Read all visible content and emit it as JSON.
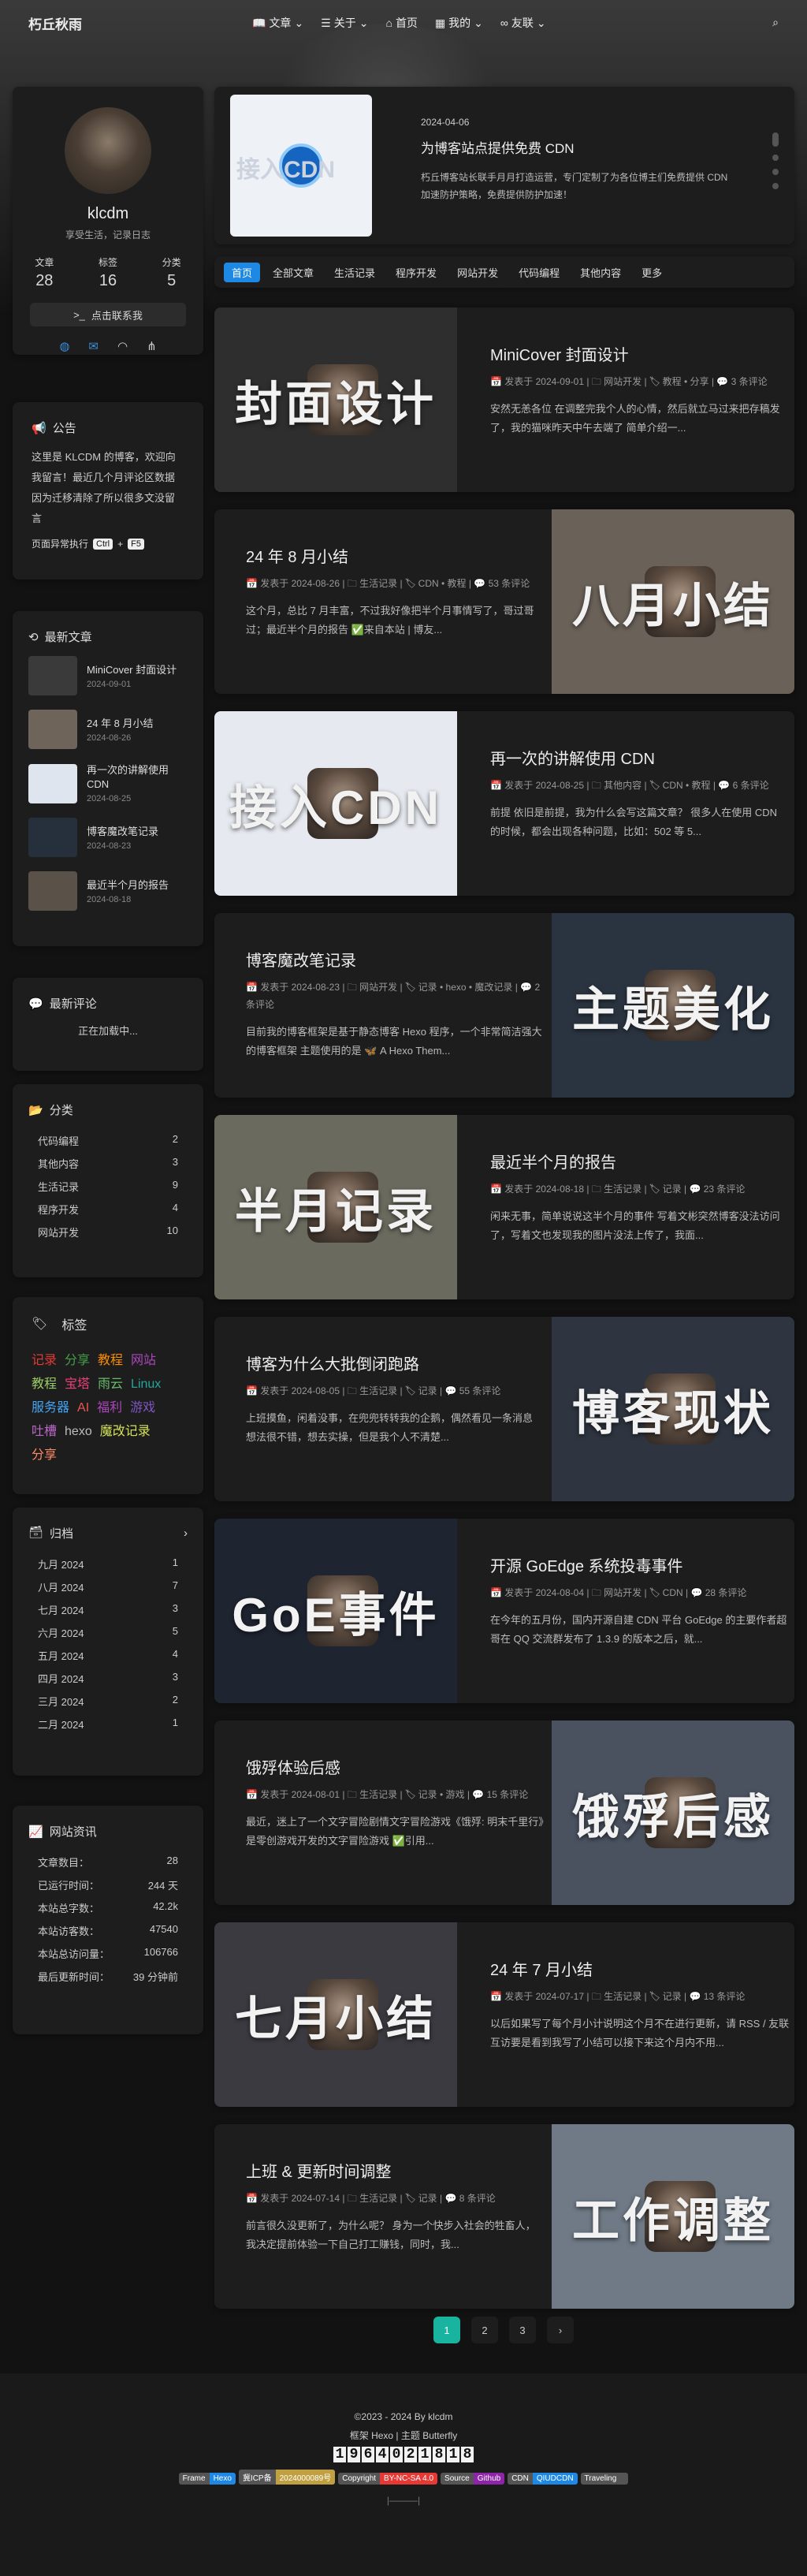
{
  "nav": {
    "brand": "朽丘秋雨",
    "items": [
      "文章",
      "关于",
      "首页",
      "我的",
      "友联"
    ]
  },
  "profile": {
    "name": "klcdm",
    "motto": "享受生活，记录日志",
    "stats": [
      {
        "label": "文章",
        "value": "28"
      },
      {
        "label": "标签",
        "value": "16"
      },
      {
        "label": "分类",
        "value": "5"
      }
    ],
    "contact": "点击联系我"
  },
  "notice": {
    "title": "公告",
    "text": "这里是 KLCDM 的博客，欢迎向我留言！最近几个月评论区数据因为迁移清除了所以很多文没留言",
    "exec_label": "页面异常执行",
    "keys": [
      "Ctrl",
      "+",
      "F5"
    ]
  },
  "recent": {
    "title": "最新文章",
    "items": [
      {
        "title": "MiniCover 封面设计",
        "date": "2024-09-01"
      },
      {
        "title": "24 年 8 月小结",
        "date": "2024-08-26"
      },
      {
        "title": "再一次的讲解使用 CDN",
        "date": "2024-08-25"
      },
      {
        "title": "博客魔改笔记录",
        "date": "2024-08-23"
      },
      {
        "title": "最近半个月的报告",
        "date": "2024-08-18"
      }
    ]
  },
  "comments": {
    "title": "最新评论",
    "loading": "正在加载中..."
  },
  "categories": {
    "title": "分类",
    "items": [
      {
        "name": "代码编程",
        "count": "2"
      },
      {
        "name": "其他内容",
        "count": "3"
      },
      {
        "name": "生活记录",
        "count": "9"
      },
      {
        "name": "程序开发",
        "count": "4"
      },
      {
        "name": "网站开发",
        "count": "10"
      }
    ]
  },
  "tags": {
    "title": "标签",
    "items": [
      {
        "name": "记录",
        "color": "#e53935"
      },
      {
        "name": "分享",
        "color": "#43a047"
      },
      {
        "name": "教程",
        "color": "#fb8c00"
      },
      {
        "name": "网站",
        "color": "#ab47bc"
      },
      {
        "name": "教程",
        "color": "#9ccc65"
      },
      {
        "name": "宝塔",
        "color": "#ec407a"
      },
      {
        "name": "雨云",
        "color": "#66bb6a"
      },
      {
        "name": "Linux",
        "color": "#26a69a"
      },
      {
        "name": "服务器",
        "color": "#42a5f5"
      },
      {
        "name": "AI",
        "color": "#ef5350"
      },
      {
        "name": "福利",
        "color": "#ab47bc"
      },
      {
        "name": "游戏",
        "color": "#7e57c2"
      },
      {
        "name": "吐槽",
        "color": "#ba68c8"
      },
      {
        "name": "hexo",
        "color": "#bdbdbd"
      },
      {
        "name": "魔改记录",
        "color": "#d4e157"
      },
      {
        "name": "分享",
        "color": "#ff8a65"
      }
    ]
  },
  "archive": {
    "title": "归档",
    "items": [
      {
        "m": "九月 2024",
        "c": "1"
      },
      {
        "m": "八月 2024",
        "c": "7"
      },
      {
        "m": "七月 2024",
        "c": "3"
      },
      {
        "m": "六月 2024",
        "c": "5"
      },
      {
        "m": "五月 2024",
        "c": "4"
      },
      {
        "m": "四月 2024",
        "c": "3"
      },
      {
        "m": "三月 2024",
        "c": "2"
      },
      {
        "m": "二月 2024",
        "c": "1"
      }
    ]
  },
  "siteinfo": {
    "title": "网站资讯",
    "items": [
      {
        "k": "文章数目：",
        "v": "28"
      },
      {
        "k": "已运行时间：",
        "v": "244 天"
      },
      {
        "k": "本站总字数：",
        "v": "42.2k"
      },
      {
        "k": "本站访客数：",
        "v": "47540"
      },
      {
        "k": "本站总访问量：",
        "v": "106766"
      },
      {
        "k": "最后更新时间：",
        "v": "39 分钟前"
      }
    ]
  },
  "featured": {
    "date": "2024-04-06",
    "title": "为博客站点提供免费 CDN",
    "desc": "朽丘博客站长联手月月打造运营，专门定制了为各位博主们免费提供 CDN 加速防护策略，免费提供防护加速！",
    "img_text": "接入CDN"
  },
  "cats_bar": [
    "首页",
    "全部文章",
    "生活记录",
    "程序开发",
    "网站开发",
    "代码编程",
    "其他内容",
    "更多"
  ],
  "posts": [
    {
      "title": "MiniCover 封面设计",
      "date": "发表于 2024-09-01",
      "cat": "网站开发",
      "tags": "教程 • 分享",
      "comments": "3 条评论",
      "desc": "安然无恙各位 在调整完我个人的心情，然后就立马过来把存稿发了，我的猫咪昨天中午去端了 简单介绍一...",
      "cover": "封面设计"
    },
    {
      "title": "24 年 8 月小结",
      "date": "发表于 2024-08-26",
      "cat": "生活记录",
      "tags": "CDN • 教程",
      "comments": "53 条评论",
      "desc": "这个月，总比 7 月丰富，不过我好像把半个月事情写了，哥过哥过；最近半个月的报告 ✅来自本站 | 博友...",
      "cover": "八月小结"
    },
    {
      "title": "再一次的讲解使用 CDN",
      "date": "发表于 2024-08-25",
      "cat": "其他内容",
      "tags": "CDN • 教程",
      "comments": "6 条评论",
      "desc": "前提 依旧是前提，我为什么会写这篇文章？ 很多人在使用 CDN 的时候，都会出现各种问题，比如：502 等 5...",
      "cover": "接入CDN"
    },
    {
      "title": "博客魔改笔记录",
      "date": "发表于 2024-08-23",
      "cat": "网站开发",
      "tags": "记录 • hexo • 魔改记录",
      "comments": "2 条评论",
      "desc": "目前我的博客框架是基于静态博客 Hexo 程序，一个非常简洁强大的博客框架 主题使用的是 🦋 A Hexo Them...",
      "cover": "主题美化"
    },
    {
      "title": "最近半个月的报告",
      "date": "发表于 2024-08-18",
      "cat": "生活记录",
      "tags": "记录",
      "comments": "23 条评论",
      "desc": "闲来无事，简单说说这半个月的事件 写着文彬突然博客没法访问了，写着文也发现我的图片没法上传了，我面...",
      "cover": "半月记录"
    },
    {
      "title": "博客为什么大批倒闭跑路",
      "date": "发表于 2024-08-05",
      "cat": "生活记录",
      "tags": "记录",
      "comments": "55 条评论",
      "desc": "上班摸鱼，闲着没事，在兜兜转转我的企鹅，偶然看见一条消息 想法很不错，想去实操，但是我个人不清楚...",
      "cover": "博客现状"
    },
    {
      "title": "开源 GoEdge 系统投毒事件",
      "date": "发表于 2024-08-04",
      "cat": "网站开发",
      "tags": "CDN",
      "comments": "28 条评论",
      "desc": "在今年的五月份，国内开源自建 CDN 平台 GoEdge 的主要作者超哥在 QQ 交流群发布了 1.3.9 的版本之后，就...",
      "cover": "GoE事件"
    },
    {
      "title": "饿殍体验后感",
      "date": "发表于 2024-08-01",
      "cat": "生活记录",
      "tags": "记录 • 游戏",
      "comments": "15 条评论",
      "desc": "最近，迷上了一个文字冒险剧情文字冒险游戏《饿殍: 明末千里行》是零创游戏开发的文字冒险游戏 ✅引用...",
      "cover": "饿殍后感"
    },
    {
      "title": "24 年 7 月小结",
      "date": "发表于 2024-07-17",
      "cat": "生活记录",
      "tags": "记录",
      "comments": "13 条评论",
      "desc": "以后如果写了每个月小计说明这个月不在进行更新，请 RSS / 友联互访要是看到我写了小结可以接下来这个月内不用...",
      "cover": "七月小结"
    },
    {
      "title": "上班 & 更新时间调整",
      "date": "发表于 2024-07-14",
      "cat": "生活记录",
      "tags": "记录",
      "comments": "8 条评论",
      "desc": "前言很久没更新了，为什么呢？ 身为一个快步入社会的牲畜人，我决定提前体验一下自己打工赚钱，同时，我...",
      "cover": "工作调整"
    }
  ],
  "pager": [
    "1",
    "2",
    "3",
    "›"
  ],
  "footer": {
    "copy": "©2023 - 2024 By klcdm",
    "frame": "框架 Hexo | 主题 Butterfly",
    "counter": [
      "1",
      "9",
      "6",
      "4",
      "0",
      "2",
      "1",
      "8",
      "1",
      "8"
    ],
    "badges": [
      {
        "l": "Frame",
        "r": "Hexo",
        "c": "#1e88e5"
      },
      {
        "l": "冀ICP备",
        "r": "2024000089号",
        "c": "#c0a040"
      },
      {
        "l": "Copyright",
        "r": "BY-NC-SA 4.0",
        "c": "#e53935"
      },
      {
        "l": "Source",
        "r": "Github",
        "c": "#8e24aa"
      },
      {
        "l": "CDN",
        "r": "QIUDCDN",
        "c": "#1e88e5"
      },
      {
        "l": "Traveling",
        "r": "",
        "c": "#555"
      }
    ]
  }
}
